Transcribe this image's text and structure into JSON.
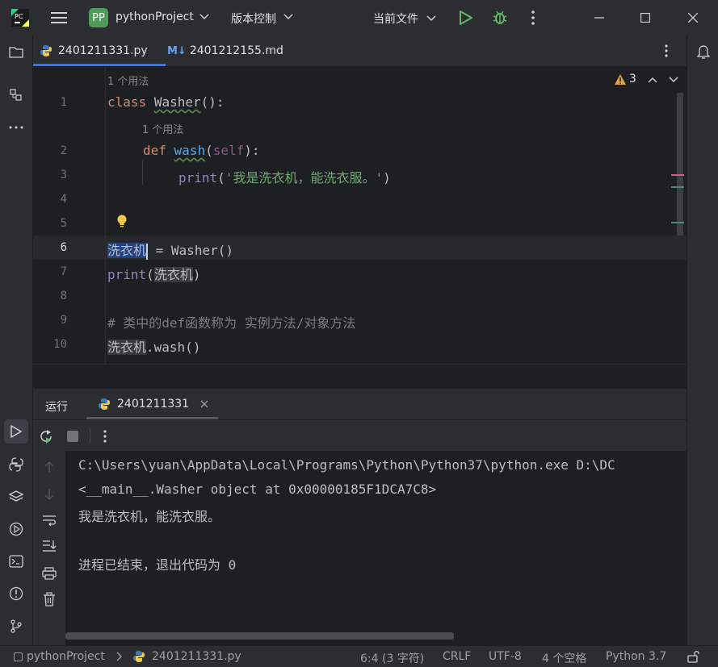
{
  "titlebar": {
    "project_badge": "PP",
    "project_name": "pythonProject",
    "vcs_label": "版本控制",
    "run_config": "当前文件"
  },
  "tabs": [
    {
      "label": "2401211331.py",
      "active": true
    },
    {
      "label": "2401212155.md",
      "active": false
    }
  ],
  "md_prefix": "M↓",
  "editor": {
    "usage_hint": "1 个用法",
    "warning_count": "3",
    "line_numbers": [
      "1",
      "2",
      "3",
      "4",
      "5",
      "6",
      "7",
      "8",
      "9",
      "10"
    ],
    "line1": {
      "kw": "class",
      "name": "Washer",
      "rest": "():"
    },
    "line2": {
      "kw": "def",
      "name": "wash",
      "open": "(",
      "self": "self",
      "close": "):"
    },
    "line3": {
      "fn": "print",
      "open": "(",
      "str": "'我是洗衣机，能洗衣服。'",
      "close": ")"
    },
    "line6": {
      "var": "洗衣机",
      "rest": " = Washer()"
    },
    "line7": {
      "fn": "print",
      "open": "(",
      "var": "洗衣机",
      "close": ")"
    },
    "line9": {
      "comment": "# 类中的def函数称为 实例方法/对象方法"
    },
    "line10": {
      "var": "洗衣机",
      "rest": ".wash()"
    }
  },
  "run": {
    "tab_run": "运行",
    "tab_file": "2401211331",
    "console": [
      "C:\\Users\\yuan\\AppData\\Local\\Programs\\Python\\Python37\\python.exe D:\\DC",
      "<__main__.Washer object at 0x00000185F1DCA7C8>",
      "我是洗衣机，能洗衣服。",
      "",
      "进程已结束，退出代码为 0"
    ]
  },
  "status": {
    "project": "pythonProject",
    "file": "2401211331.py",
    "position": "6:4 (3 字符)",
    "line_sep": "CRLF",
    "encoding": "UTF-8",
    "indent": "4 个空格",
    "interpreter": "Python 3.7"
  },
  "colors": {
    "accent": "#3574f0",
    "run_green": "#5fb865",
    "badge": "#4f9c5a"
  }
}
